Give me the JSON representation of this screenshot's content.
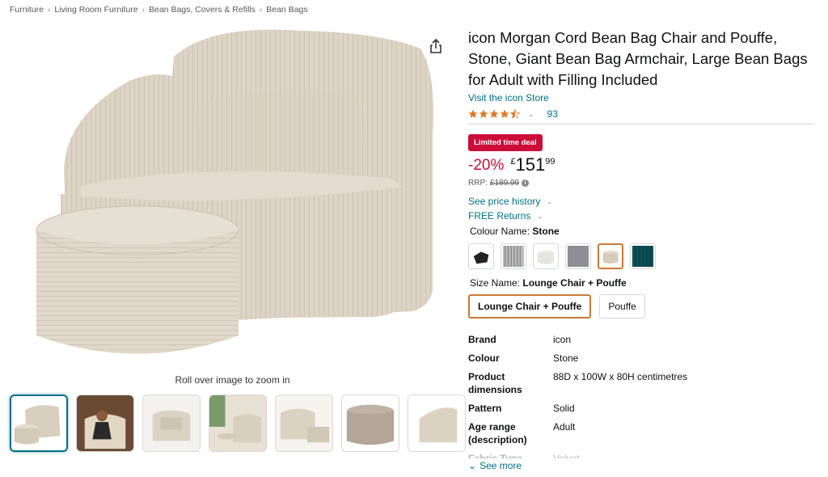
{
  "breadcrumb": {
    "items": [
      "Furniture",
      "Living Room Furniture",
      "Bean Bags, Covers & Refills",
      "Bean Bags"
    ],
    "separator": "›"
  },
  "gallery": {
    "zoom_hint": "Roll over image to zoom in",
    "main_image": "bean-bag-chair-and-pouffe",
    "thumbnails": [
      "chair-and-pouffe",
      "woman-sitting-in-chair",
      "chair-front-view",
      "lounge-scene",
      "chair-and-pouffe-alt",
      "pouffe-closeup",
      "chair-side-view"
    ]
  },
  "product": {
    "title": "icon Morgan Cord Bean Bag Chair and Pouffe, Stone, Giant Bean Bag Armchair, Large Bean Bags for Adult with Filling Included",
    "store_link": "Visit the icon Store",
    "rating": 4.5,
    "rating_count": "93",
    "deal_badge": "Limited time deal",
    "discount": "-20%",
    "currency": "£",
    "price_whole": "151",
    "price_fraction": "99",
    "rrp_label": "RRP:",
    "rrp_value": "£189.99",
    "price_history": "See price history",
    "free_returns": "FREE Returns"
  },
  "colour": {
    "label": "Colour Name:",
    "value": "Stone",
    "swatches": [
      "black",
      "grey-stripe",
      "white",
      "slate",
      "stone",
      "teal"
    ],
    "selected_index": 4
  },
  "size": {
    "label": "Size Name:",
    "value": "Lounge Chair + Pouffe",
    "options": [
      "Lounge Chair + Pouffe",
      "Pouffe"
    ]
  },
  "specs": {
    "rows": [
      {
        "key": "Brand",
        "value": "icon"
      },
      {
        "key": "Colour",
        "value": "Stone"
      },
      {
        "key": "Product dimensions",
        "value": "88D x 100W x 80H centimetres"
      },
      {
        "key": "Pattern",
        "value": "Solid"
      },
      {
        "key": "Age range (description)",
        "value": "Adult"
      },
      {
        "key": "Fabric Type",
        "value": "Velvet"
      }
    ],
    "see_more": "See more"
  },
  "colors": {
    "link": "#007185",
    "deal": "#cc0c39",
    "star": "#de7921",
    "selected_border": "#c87a3a"
  }
}
